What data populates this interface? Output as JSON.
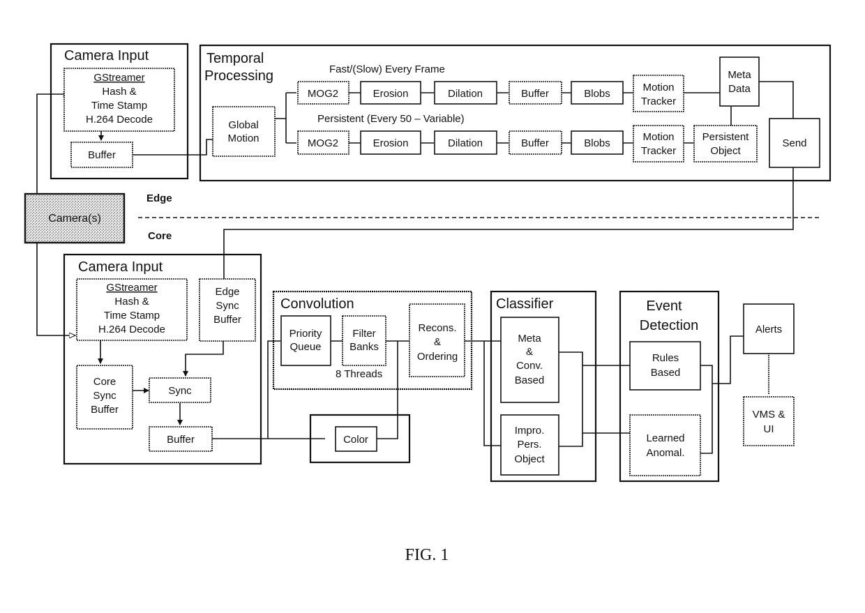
{
  "figure_caption": "FIG. 1",
  "zones": {
    "edge": "Edge",
    "core": "Core"
  },
  "cameras": {
    "label": "Camera(s)"
  },
  "edge_camera_input": {
    "title": "Camera Input",
    "decoder": {
      "line1": "GStreamer",
      "line2": "Hash &",
      "line3": "Time Stamp",
      "line4": "H.264 Decode"
    },
    "buffer": "Buffer"
  },
  "temporal_processing": {
    "title_line1": "Temporal",
    "title_line2": "Processing",
    "global_motion": {
      "line1": "Global",
      "line2": "Motion"
    },
    "fast_path_label": "Fast/(Slow) Every Frame",
    "persistent_path_label": "Persistent (Every 50 – Variable)",
    "fast_row": [
      "MOG2",
      "Erosion",
      "Dilation",
      "Buffer",
      "Blobs"
    ],
    "persistent_row": [
      "MOG2",
      "Erosion",
      "Dilation",
      "Buffer",
      "Blobs"
    ],
    "motion_tracker": {
      "line1": "Motion",
      "line2": "Tracker"
    },
    "meta_data": {
      "line1": "Meta",
      "line2": "Data"
    },
    "persistent_object": {
      "line1": "Persistent",
      "line2": "Object"
    },
    "send": "Send"
  },
  "core_camera_input": {
    "title": "Camera Input",
    "decoder": {
      "line1": "GStreamer",
      "line2": "Hash &",
      "line3": "Time Stamp",
      "line4": "H.264 Decode"
    },
    "edge_sync_buffer": {
      "line1": "Edge",
      "line2": "Sync",
      "line3": "Buffer"
    },
    "core_sync_buffer": {
      "line1": "Core",
      "line2": "Sync",
      "line3": "Buffer"
    },
    "sync": "Sync",
    "buffer": "Buffer"
  },
  "convolution": {
    "title": "Convolution",
    "priority_queue": {
      "line1": "Priority",
      "line2": "Queue"
    },
    "filter_banks": {
      "line1": "Filter",
      "line2": "Banks"
    },
    "threads_note": "8 Threads",
    "recons": {
      "line1": "Recons.",
      "line2": "&",
      "line3": "Ordering"
    },
    "color": "Color"
  },
  "classifier": {
    "title": "Classifier",
    "meta_conv": {
      "line1": "Meta",
      "line2": "&",
      "line3": "Conv.",
      "line4": "Based"
    },
    "impro": {
      "line1": "Impro.",
      "line2": "Pers.",
      "line3": "Object"
    }
  },
  "event_detection": {
    "title_line1": "Event",
    "title_line2": "Detection",
    "rules": {
      "line1": "Rules",
      "line2": "Based"
    },
    "learned": {
      "line1": "Learned",
      "line2": "Anomal."
    }
  },
  "outputs": {
    "alerts": "Alerts",
    "vms": {
      "line1": "VMS &",
      "line2": "UI"
    }
  }
}
